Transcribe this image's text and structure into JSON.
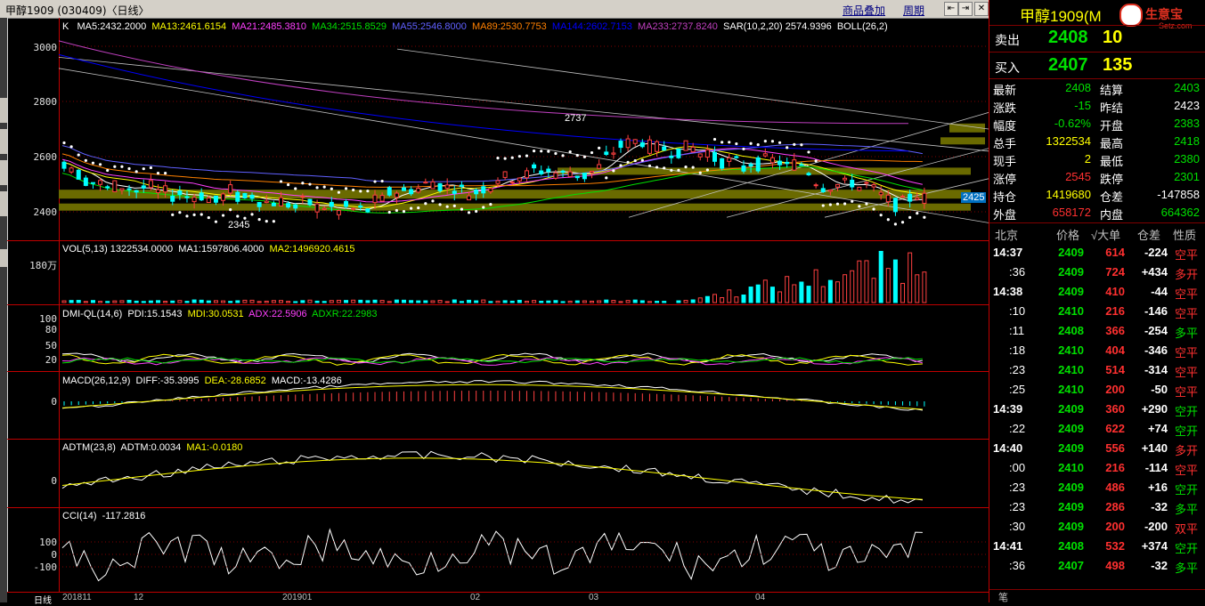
{
  "window": {
    "title": "甲醇1909 (030409)〈日线〉",
    "link_overlay": "商品叠加",
    "link_period": "周期",
    "btn_icons": [
      "expand-left-icon",
      "expand-right-icon",
      "close-icon"
    ]
  },
  "main_chart": {
    "info_k": "K",
    "ma5": "MA5:2432.2000",
    "ma13": "MA13:2461.6154",
    "ma21": "MA21:2485.3810",
    "ma34": "MA34:2515.8529",
    "ma55": "MA55:2546.8000",
    "ma89": "MA89:2530.7753",
    "ma144": "MA144:2602.7153",
    "ma233": "MA233:2737.8240",
    "sar": "SAR(10,2,20)  2574.9396",
    "boll": "BOLL(26,2)",
    "y_labels": [
      "3000",
      "2800",
      "2600",
      "2400"
    ],
    "high_label": "2737",
    "low_label": "2345",
    "price_tag": "2425",
    "colors": {
      "ma5": "#ffffff",
      "ma13": "#ffff00",
      "ma21": "#ff40ff",
      "ma34": "#00e000",
      "ma55": "#6060ff",
      "ma89": "#ff8000",
      "ma144": "#0000ff",
      "ma233": "#c040c0"
    }
  },
  "volume": {
    "info": "VOL(5,13)  1322534.0000",
    "ma1": "MA1:1597806.4000",
    "ma2": "MA2:1496920.4615",
    "y_label": "180万"
  },
  "dmi": {
    "info": "DMI-QL(14,6)",
    "pdi": "PDI:15.1543",
    "mdi": "MDI:30.0531",
    "adx": "ADX:22.5906",
    "adxr": "ADXR:22.2983",
    "y_labels": [
      "100",
      "80",
      "50",
      "20"
    ]
  },
  "macd": {
    "info": "MACD(26,12,9)",
    "diff": "DIFF:-35.3995",
    "dea": "DEA:-28.6852",
    "macd": "MACD:-13.4286",
    "y_label": "0"
  },
  "adtm": {
    "info": "ADTM(23,8)",
    "adtm": "ADTM:0.0034",
    "ma1": "MA1:-0.0180",
    "y_label": "0"
  },
  "cci": {
    "info": "CCI(14)",
    "value": "-117.2816",
    "y_labels": [
      "100",
      "0",
      "-100"
    ]
  },
  "x_axis": {
    "corner": "日线",
    "labels": [
      "201811",
      "12",
      "201901",
      "02",
      "03",
      "04"
    ]
  },
  "right_panel": {
    "title": "甲醇1909(M",
    "logo_text": "生意宝",
    "logo_sub": "Setz.com",
    "sell_label": "卖出",
    "sell_price": "2408",
    "sell_vol": "10",
    "buy_label": "买入",
    "buy_price": "2407",
    "buy_vol": "135",
    "stats": [
      {
        "l": "最新",
        "v": "2408",
        "c": "green",
        "l2": "结算",
        "v2": "2403",
        "c2": "green"
      },
      {
        "l": "涨跌",
        "v": "-15",
        "c": "green",
        "l2": "昨结",
        "v2": "2423",
        "c2": "white"
      },
      {
        "l": "幅度",
        "v": "-0.62%",
        "c": "green",
        "l2": "开盘",
        "v2": "2383",
        "c2": "green"
      },
      {
        "l": "总手",
        "v": "1322534",
        "c": "yellow",
        "l2": "最高",
        "v2": "2418",
        "c2": "green"
      },
      {
        "l": "现手",
        "v": "2",
        "c": "yellow",
        "l2": "最低",
        "v2": "2380",
        "c2": "green"
      },
      {
        "l": "涨停",
        "v": "2545",
        "c": "red",
        "l2": "跌停",
        "v2": "2301",
        "c2": "green"
      },
      {
        "l": "持仓",
        "v": "1419680",
        "c": "yellow",
        "l2": "仓差",
        "v2": "-147858",
        "c2": "white"
      },
      {
        "l": "外盘",
        "v": "658172",
        "c": "red",
        "l2": "内盘",
        "v2": "664362",
        "c2": "green"
      }
    ],
    "tick_header": {
      "place": "北京",
      "price": "价格",
      "vol": "√大单",
      "diff": "仓差",
      "nature": "性质"
    },
    "ticks": [
      {
        "time": "14:37",
        "price": "2409",
        "vol": "614",
        "diff": "-224",
        "nature": "空平",
        "nc": "red",
        "bold": true
      },
      {
        "time": ":36",
        "price": "2409",
        "vol": "724",
        "diff": "+434",
        "nature": "多开",
        "nc": "red",
        "bold": false
      },
      {
        "time": "14:38",
        "price": "2409",
        "vol": "410",
        "diff": "-44",
        "nature": "空平",
        "nc": "red",
        "bold": true
      },
      {
        "time": ":10",
        "price": "2410",
        "vol": "216",
        "diff": "-146",
        "nature": "空平",
        "nc": "red",
        "bold": false
      },
      {
        "time": ":11",
        "price": "2408",
        "vol": "366",
        "diff": "-254",
        "nature": "多平",
        "nc": "green",
        "bold": false
      },
      {
        "time": ":18",
        "price": "2410",
        "vol": "404",
        "diff": "-346",
        "nature": "空平",
        "nc": "red",
        "bold": false
      },
      {
        "time": ":23",
        "price": "2410",
        "vol": "514",
        "diff": "-314",
        "nature": "空平",
        "nc": "red",
        "bold": false
      },
      {
        "time": ":25",
        "price": "2410",
        "vol": "200",
        "diff": "-50",
        "nature": "空平",
        "nc": "red",
        "bold": false
      },
      {
        "time": "14:39",
        "price": "2409",
        "vol": "360",
        "diff": "+290",
        "nature": "空开",
        "nc": "green",
        "bold": true
      },
      {
        "time": ":22",
        "price": "2409",
        "vol": "622",
        "diff": "+74",
        "nature": "空开",
        "nc": "green",
        "bold": false
      },
      {
        "time": "14:40",
        "price": "2409",
        "vol": "556",
        "diff": "+140",
        "nature": "多开",
        "nc": "red",
        "bold": true
      },
      {
        "time": ":00",
        "price": "2410",
        "vol": "216",
        "diff": "-114",
        "nature": "空平",
        "nc": "red",
        "bold": false
      },
      {
        "time": ":23",
        "price": "2409",
        "vol": "486",
        "diff": "+16",
        "nature": "空开",
        "nc": "green",
        "bold": false
      },
      {
        "time": ":23",
        "price": "2409",
        "vol": "286",
        "diff": "-32",
        "nature": "多平",
        "nc": "green",
        "bold": false
      },
      {
        "time": ":30",
        "price": "2409",
        "vol": "200",
        "diff": "-200",
        "nature": "双平",
        "nc": "red",
        "bold": false
      },
      {
        "time": "14:41",
        "price": "2408",
        "vol": "532",
        "diff": "+374",
        "nature": "空开",
        "nc": "green",
        "bold": true
      },
      {
        "time": ":36",
        "price": "2407",
        "vol": "498",
        "diff": "-32",
        "nature": "多平",
        "nc": "green",
        "bold": false
      }
    ],
    "footer_tab": "笔"
  }
}
